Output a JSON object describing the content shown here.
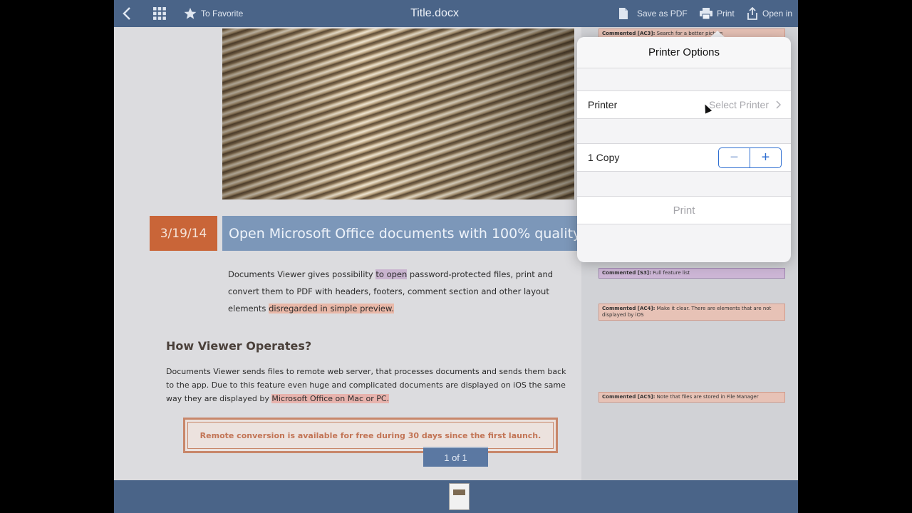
{
  "topbar": {
    "back": "‹",
    "favorite_label": "To Favorite",
    "title": "Title.docx",
    "save_pdf_label": "Save as PDF",
    "print_label": "Print",
    "open_in_label": "Open in"
  },
  "document": {
    "date": "3/19/14",
    "heading": "Open Microsoft Office documents with 100% quality",
    "para1": {
      "a": "Documents Viewer gives possibility ",
      "hl1": "to open",
      "b": " password-protected files, print and convert them to PDF with headers, footers, comment section and other layout elements ",
      "hl2": "disregarded in simple preview."
    },
    "subheading": "How Viewer Operates?",
    "para2": {
      "a": "Documents Viewer sends files to remote web server, that processes documents and sends them back to the app. Due to this feature even huge and complicated documents are displayed on iOS the same way they are displayed by ",
      "hl": "Microsoft Office on Mac or PC."
    },
    "note": "Remote conversion is available for free during 30 days since the first launch.",
    "page_indicator": "1 of 1"
  },
  "comments": [
    {
      "tag": "Commented [AC3]:",
      "text": "Search for a better picture"
    },
    {
      "tag": "Commented [S3]:",
      "text": "Full feature list"
    },
    {
      "tag": "Commented [AC4]:",
      "text": "Make it clear. There are elements that are not displayed by iOS"
    },
    {
      "tag": "Commented [AC5]:",
      "text": "Note that files are stored in File Manager"
    }
  ],
  "printer_options": {
    "title": "Printer Options",
    "printer_label": "Printer",
    "printer_value": "Select Printer",
    "copies_label": "1 Copy",
    "minus": "−",
    "plus": "+",
    "print_button": "Print"
  },
  "colors": {
    "toolbar": "#4a6488",
    "accent_blue": "#2f6fd1",
    "date_box": "#c96538",
    "heading_box": "#7c97b9"
  }
}
